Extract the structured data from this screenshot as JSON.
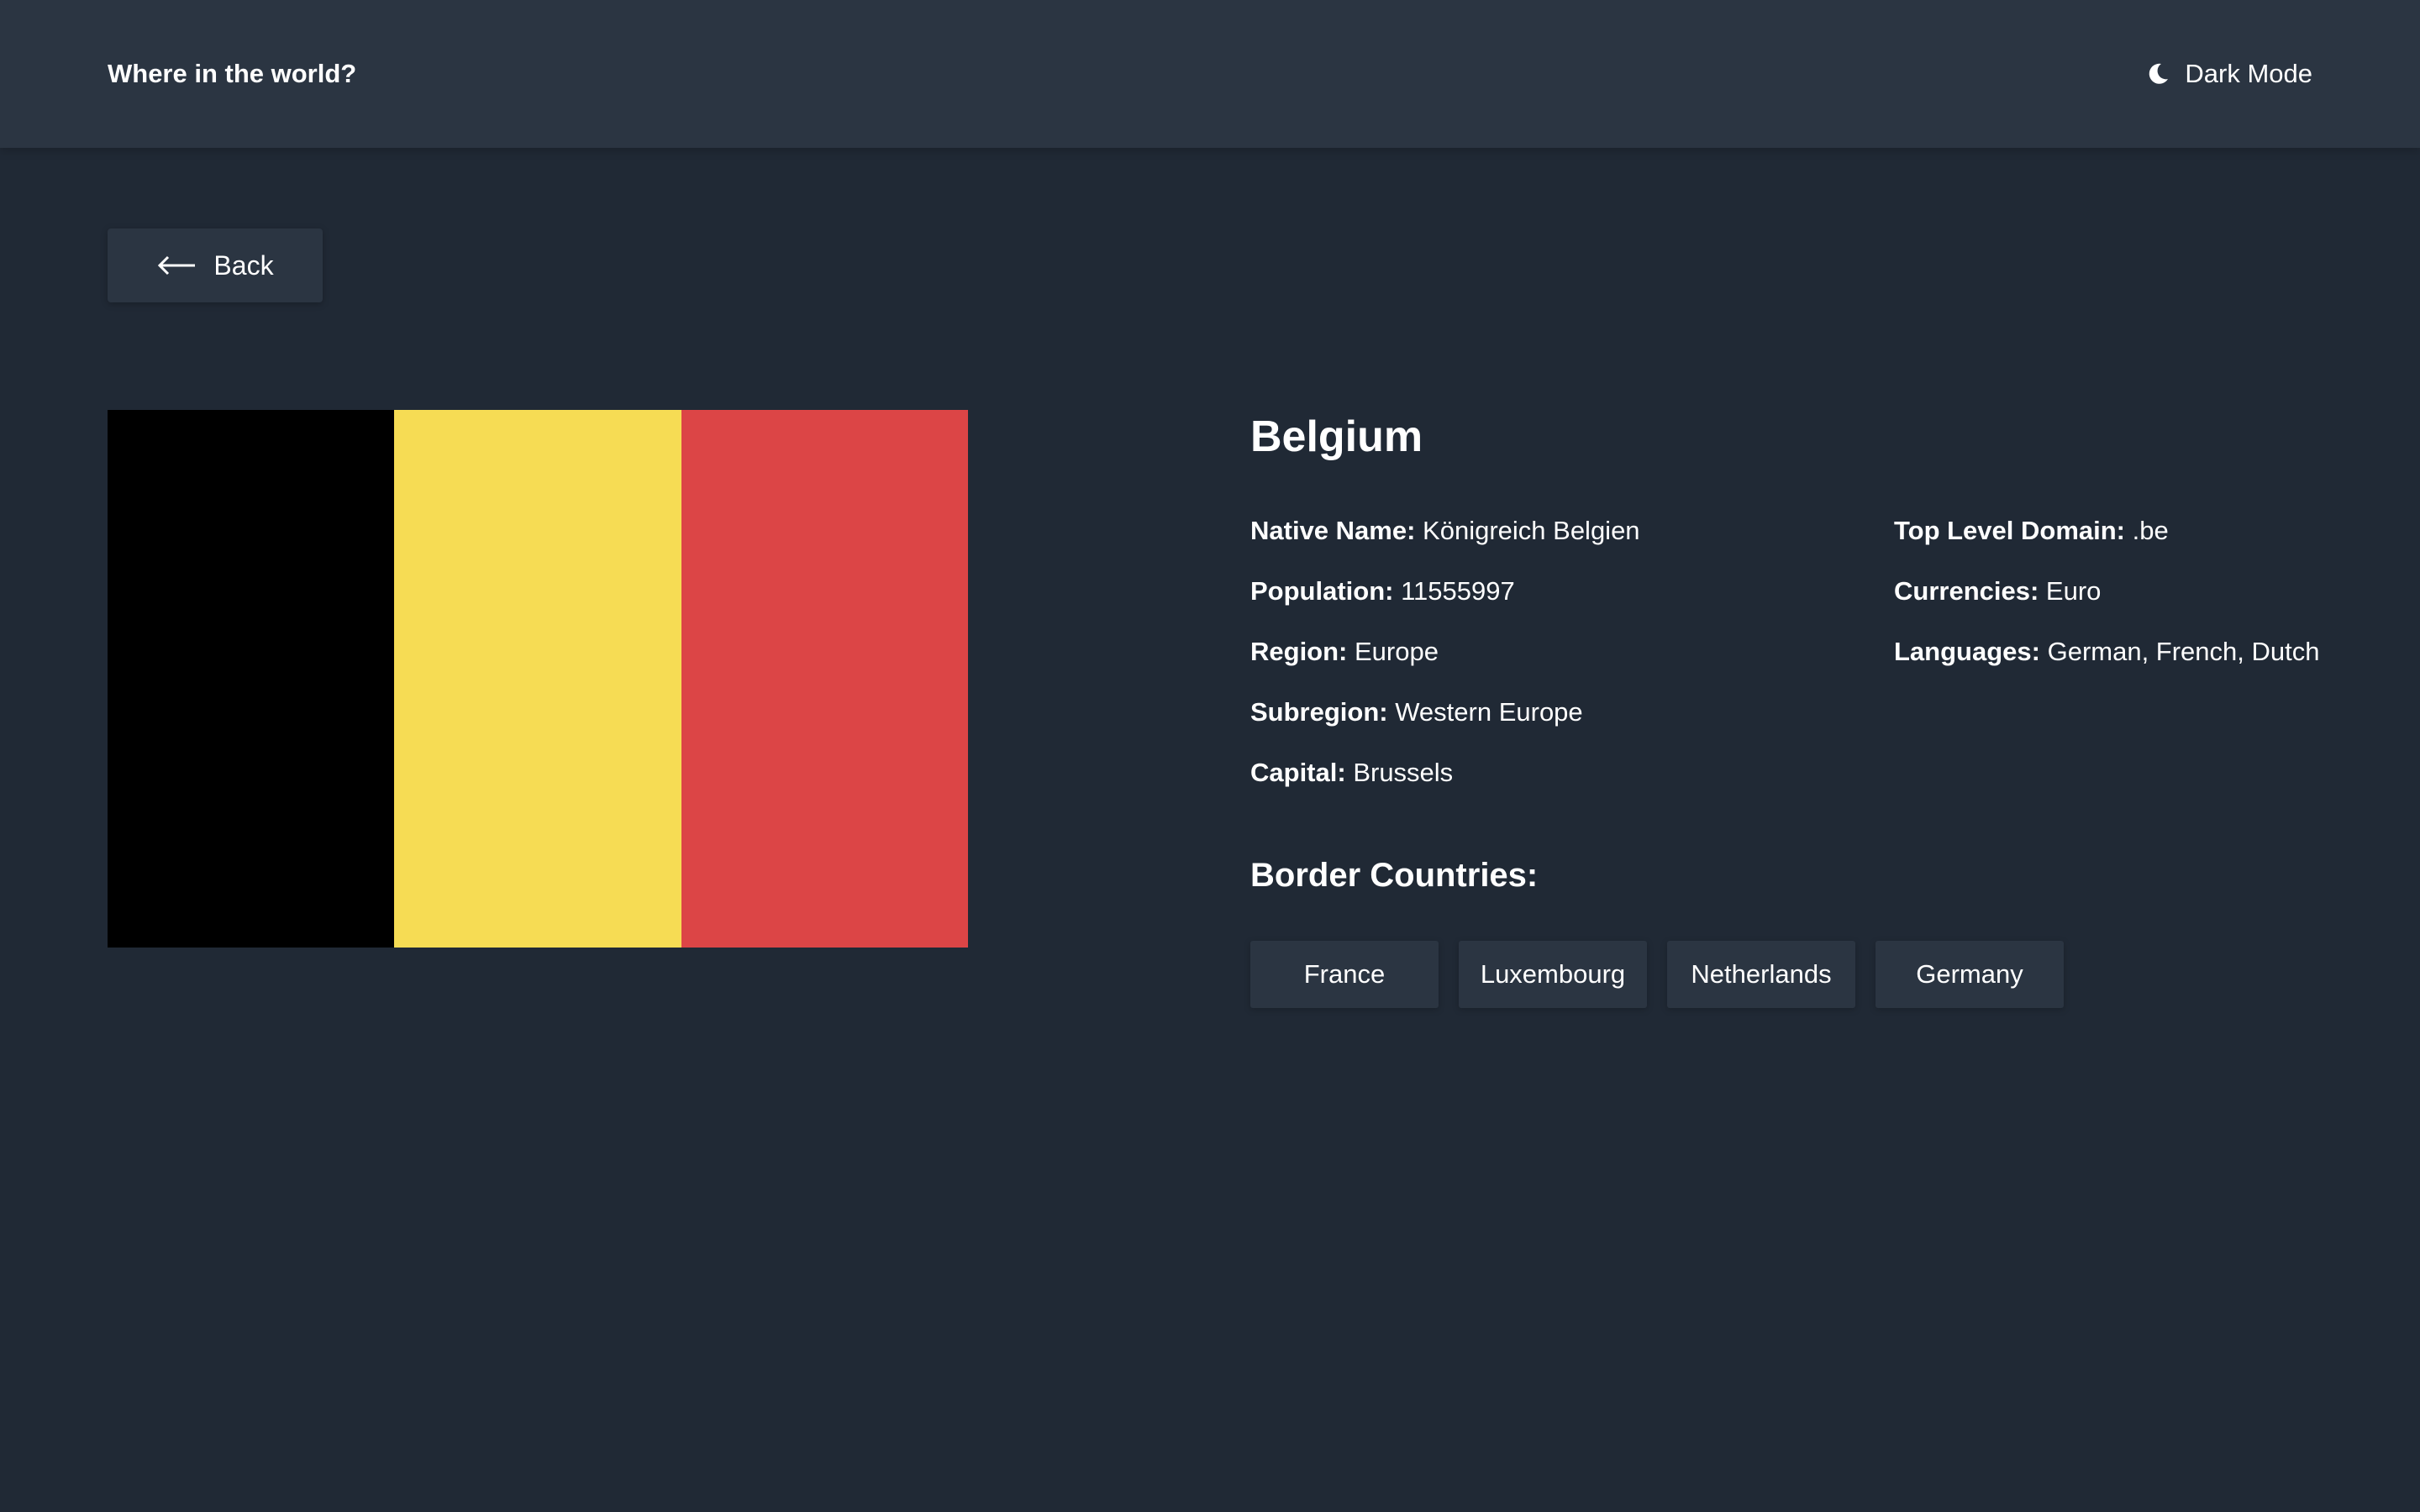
{
  "header": {
    "title": "Where in the world?",
    "theme_toggle_label": "Dark Mode",
    "theme_icon": "moon-icon"
  },
  "back_button": {
    "label": "Back",
    "icon": "arrow-left-icon"
  },
  "country": {
    "name": "Belgium",
    "flag": {
      "stripes": [
        "#000000",
        "#f6dc54",
        "#dc4546"
      ]
    },
    "details_left": [
      {
        "key": "Native Name:",
        "value": "Königreich Belgien"
      },
      {
        "key": "Population:",
        "value": "11555997"
      },
      {
        "key": "Region:",
        "value": "Europe"
      },
      {
        "key": "Subregion:",
        "value": "Western Europe"
      },
      {
        "key": "Capital:",
        "value": "Brussels"
      }
    ],
    "details_right": [
      {
        "key": "Top Level Domain:",
        "value": ".be"
      },
      {
        "key": "Currencies:",
        "value": "Euro"
      },
      {
        "key": "Languages:",
        "value": "German, French, Dutch"
      }
    ],
    "border_title": "Border Countries:",
    "borders": [
      "France",
      "Luxembourg",
      "Netherlands",
      "Germany"
    ]
  },
  "colors": {
    "background": "#202935",
    "element": "#2b3542",
    "text": "#ffffff"
  }
}
